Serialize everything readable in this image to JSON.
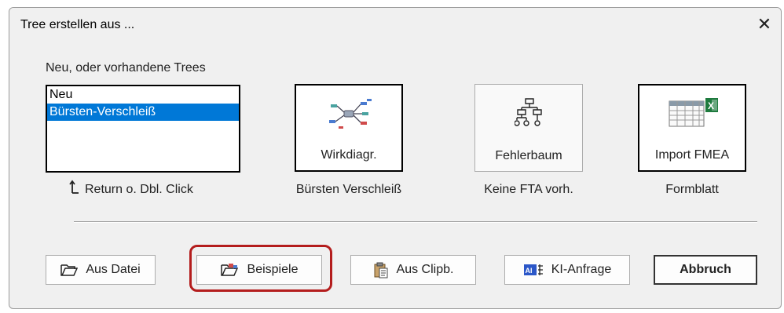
{
  "window": {
    "title": "Tree erstellen aus ...",
    "close_symbol": "✕"
  },
  "trees": {
    "heading": "Neu, oder vorhandene Trees",
    "items": [
      {
        "label": "Neu",
        "selected": false
      },
      {
        "label": "Bürsten-Verschleiß",
        "selected": true
      }
    ],
    "hint": "Return o. Dbl. Click"
  },
  "tiles": [
    {
      "label": "Wirkdiagr.",
      "caption": "Bürsten Verschleiß",
      "icon": "mindmap-icon"
    },
    {
      "label": "Fehlerbaum",
      "caption": "Keine FTA vorh.",
      "icon": "fault-tree-icon"
    },
    {
      "label": "Import FMEA",
      "caption": "Formblatt",
      "icon": "excel-table-icon"
    }
  ],
  "buttons": {
    "aus_datei": "Aus Datei",
    "beispiele": "Beispiele",
    "aus_clipb": "Aus Clipb.",
    "ki_anfrage": "KI-Anfrage",
    "abbruch": "Abbruch"
  },
  "colors": {
    "selection": "#0078d7",
    "highlight": "#b41d1d",
    "dialog_bg": "#f0f0f0"
  }
}
